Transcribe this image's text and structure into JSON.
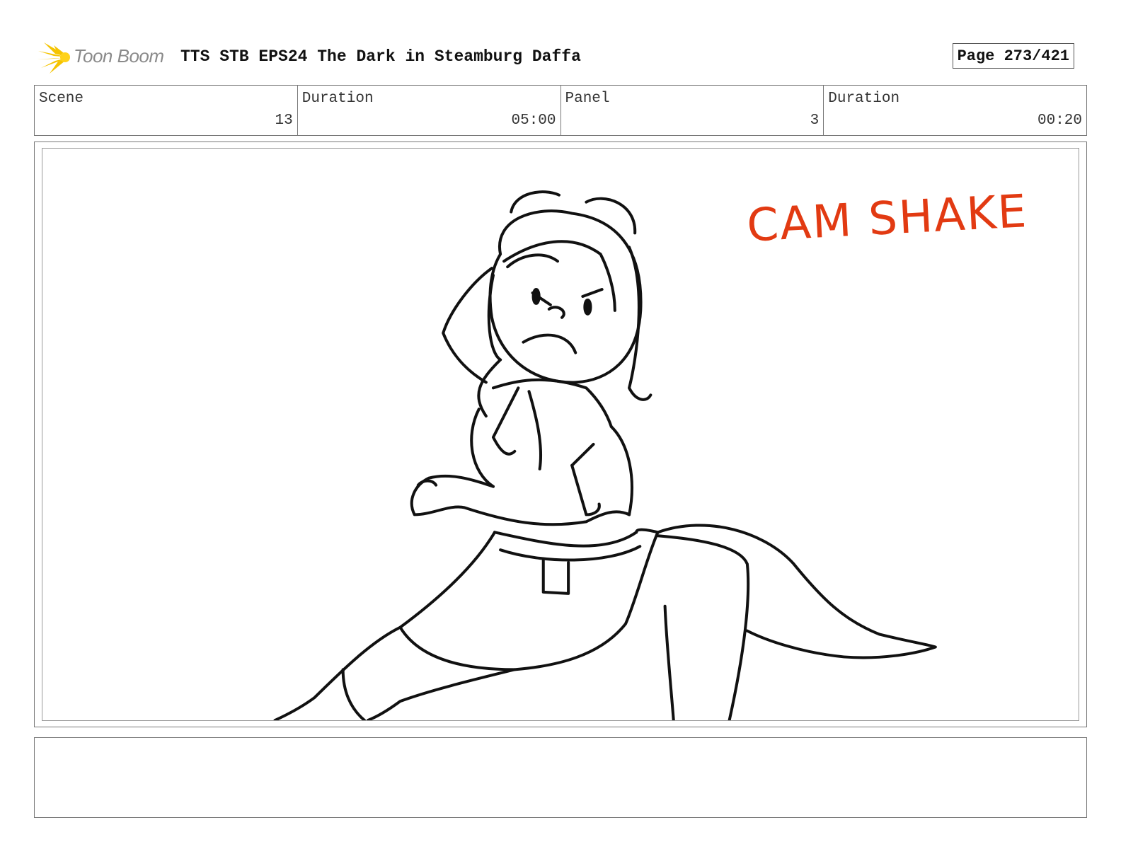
{
  "header": {
    "logo_text": "Toon Boom",
    "title": "TTS STB EPS24 The Dark in Steamburg Daffa",
    "page_label": "Page 273/421"
  },
  "info": {
    "scene_label": "Scene",
    "scene_value": "13",
    "scene_duration_label": "Duration",
    "scene_duration_value": "05:00",
    "panel_label": "Panel",
    "panel_value": "3",
    "panel_duration_label": "Duration",
    "panel_duration_value": "00:20"
  },
  "panel": {
    "annotation": "CAM SHAKE"
  },
  "colors": {
    "annotation": "#e23a12",
    "logo_yellow": "#f5c400",
    "border": "#777777"
  },
  "icons": {
    "logo": "toon-boom-starburst-icon"
  }
}
